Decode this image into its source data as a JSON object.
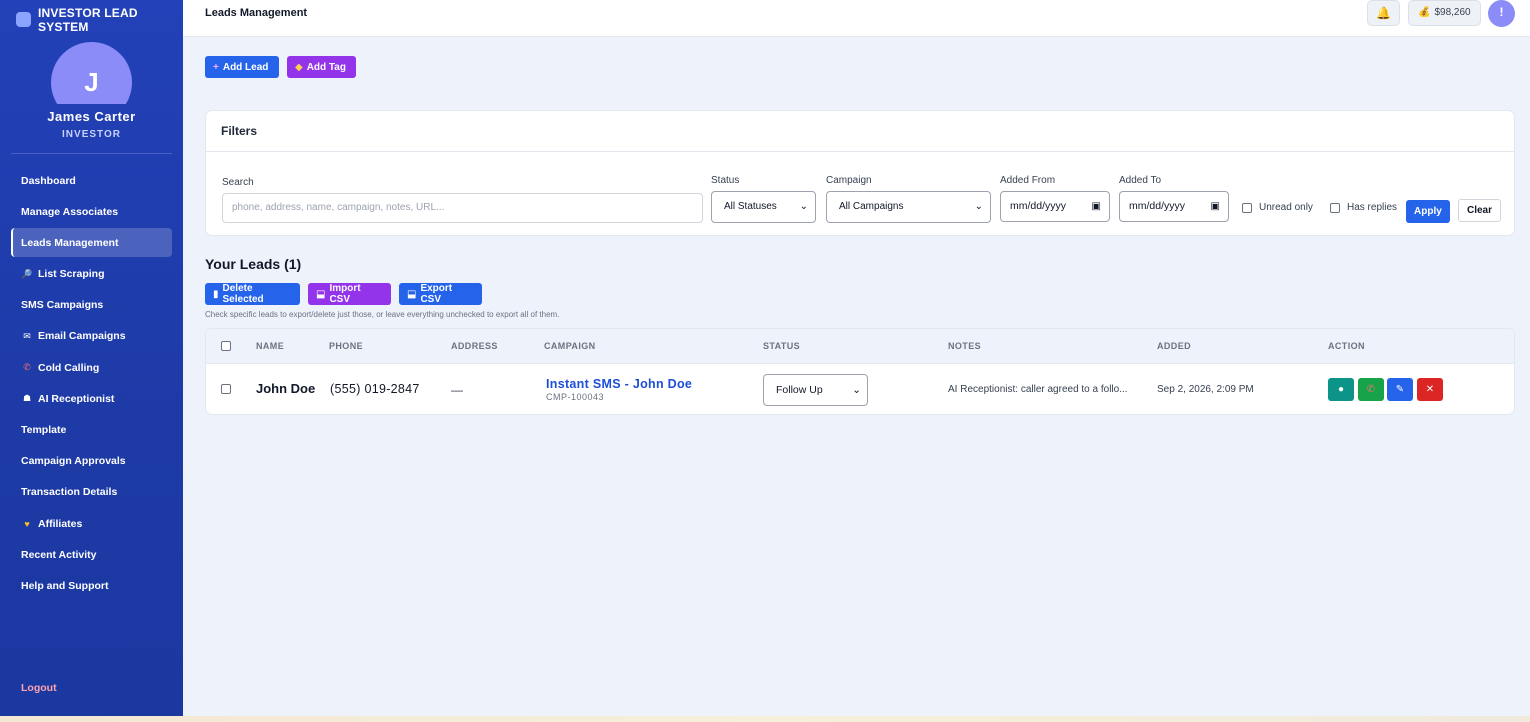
{
  "brand": {
    "name": "INVESTOR LEAD SYSTEM"
  },
  "user": {
    "initial": "J",
    "name": "James Carter",
    "role": "INVESTOR"
  },
  "sidebar": {
    "items": [
      {
        "label": "Dashboard",
        "icon": ""
      },
      {
        "label": "Manage Associates",
        "icon": ""
      },
      {
        "label": "Leads Management",
        "icon": "",
        "active": true
      },
      {
        "label": "List Scraping",
        "icon": "magnifier-icon"
      },
      {
        "label": "SMS Campaigns",
        "icon": ""
      },
      {
        "label": "Email Campaigns",
        "icon": "email-icon"
      },
      {
        "label": "Cold Calling",
        "icon": "phone-icon"
      },
      {
        "label": "AI Receptionist",
        "icon": "robot-icon"
      },
      {
        "label": "Template",
        "icon": ""
      },
      {
        "label": "Campaign Approvals",
        "icon": ""
      },
      {
        "label": "Transaction Details",
        "icon": ""
      },
      {
        "label": "Affiliates",
        "icon": "handshake-icon"
      },
      {
        "label": "Recent Activity",
        "icon": ""
      },
      {
        "label": "Help and Support",
        "icon": ""
      }
    ],
    "logout_label": "Logout"
  },
  "header": {
    "title": "Leads Management",
    "balance": "$98,260",
    "user_initial": "!"
  },
  "actions": {
    "add_lead": "Add Lead",
    "add_tag": "Add Tag"
  },
  "filters": {
    "title": "Filters",
    "search_label": "Search",
    "search_placeholder": "phone, address, name, campaign, notes, URL...",
    "status_label": "Status",
    "status_value": "All Statuses",
    "campaign_label": "Campaign",
    "campaign_value": "All Campaigns",
    "added_from_label": "Added From",
    "added_from_value": "mm/dd/yyyy",
    "added_to_label": "Added To",
    "added_to_value": "mm/dd/yyyy",
    "unread_only_label": "Unread only",
    "has_replies_label": "Has replies",
    "apply_label": "Apply",
    "clear_label": "Clear"
  },
  "leads": {
    "title": "Your Leads (1)",
    "delete_label": "Delete Selected",
    "import_label": "Import CSV",
    "export_label": "Export CSV",
    "hint": "Check specific leads to export/delete just those, or leave everything unchecked to export all of them.",
    "columns": [
      "NAME",
      "PHONE",
      "ADDRESS",
      "CAMPAIGN",
      "STATUS",
      "NOTES",
      "ADDED",
      "ACTION"
    ],
    "rows": [
      {
        "name": "John Doe",
        "phone": "(555) 019-2847",
        "address": "—",
        "campaign_name": "Instant SMS - John Doe",
        "campaign_id": "CMP-100043",
        "status": "Follow Up",
        "notes": "AI Receptionist: caller agreed to a follo...",
        "added": "Sep 2, 2026, 2:09 PM"
      }
    ]
  },
  "colors": {
    "sidebar": "#1d3aa6",
    "primary": "#2563eb",
    "purple": "#9333ea",
    "teal": "#0d9488",
    "green": "#16a34a",
    "red": "#dc2626"
  }
}
